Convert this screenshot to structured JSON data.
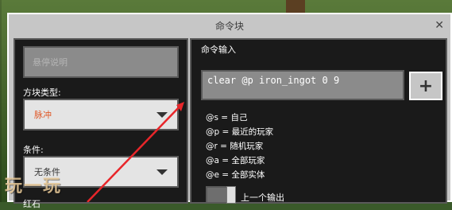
{
  "window": {
    "title": "命令块"
  },
  "left": {
    "hover_note_placeholder": "悬停说明",
    "block_type_label": "方块类型:",
    "block_type_value": "脉冲",
    "condition_label": "条件:",
    "condition_value": "无条件",
    "redstone_label_partial": "红石"
  },
  "right": {
    "command_input_label": "命令输入",
    "command_value": "clear @p iron_ingot 0 9",
    "help_lines": [
      "@s = 自己",
      "@p = 最近的玩家",
      "@r = 随机玩家",
      "@a = 全部玩家",
      "@e = 全部实体"
    ],
    "previous_output_label": "上一个输出"
  },
  "watermark": "玩一玩",
  "colors": {
    "accent_text": "#e05a2a",
    "panel_bg": "#1a1a1a",
    "arrow": "#e8262a"
  }
}
